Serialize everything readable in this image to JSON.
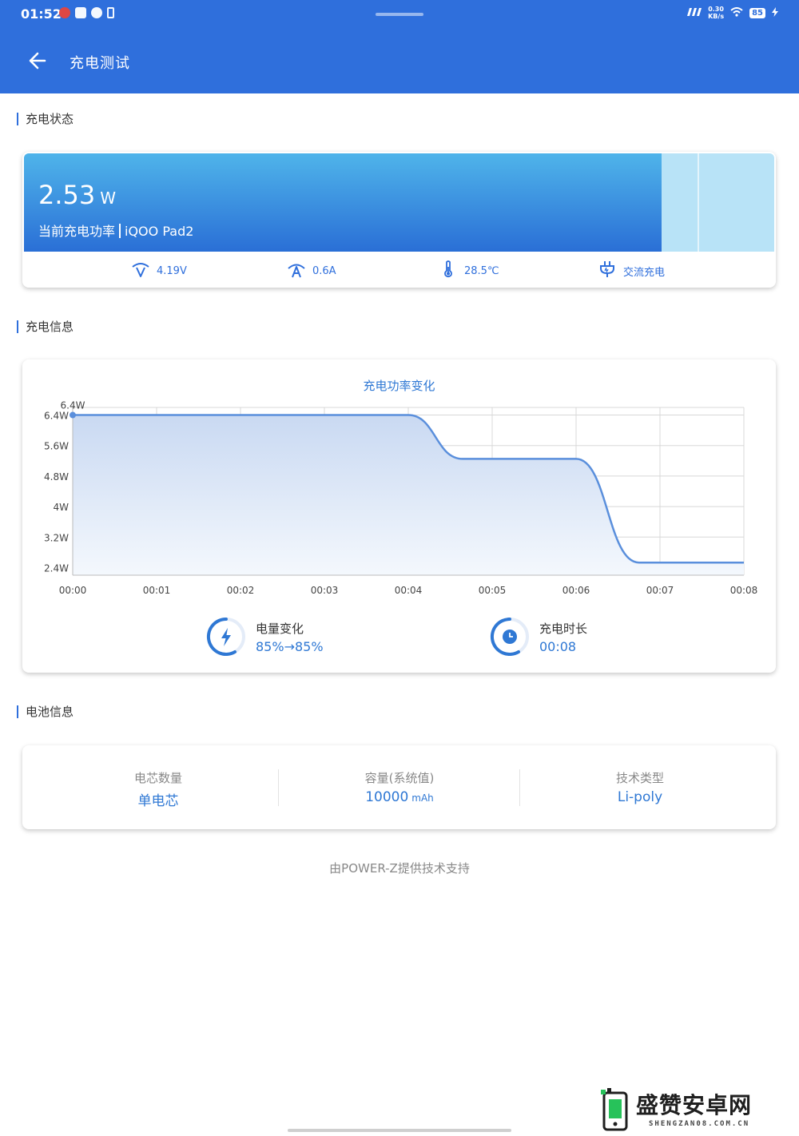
{
  "status_bar": {
    "time": "01:52",
    "net_speed_value": "0.30",
    "net_speed_unit": "KB/s",
    "battery": "85"
  },
  "header": {
    "title": "充电测试"
  },
  "sections": {
    "charge_status": "充电状态",
    "charge_info": "充电信息",
    "battery_info": "电池信息"
  },
  "charge_status": {
    "power_value": "2.53",
    "power_unit": "W",
    "caption_label": "当前充电功率",
    "device": "iQOO Pad2",
    "power_fraction": 0.85,
    "voltage": "4.19V",
    "current": "0.6A",
    "temperature": "28.5℃",
    "charger_type": "交流充电"
  },
  "chart_data": {
    "type": "area",
    "title": "充电功率变化",
    "x": [
      "00:00",
      "00:01",
      "00:02",
      "00:03",
      "00:04",
      "00:05",
      "00:06",
      "00:07",
      "00:08"
    ],
    "y_ticks": [
      "2.4W",
      "3.2W",
      "4W",
      "4.8W",
      "5.6W",
      "6.4W"
    ],
    "ylim": [
      2.2,
      6.6
    ],
    "series": [
      {
        "points": [
          [
            0,
            6.4
          ],
          [
            1,
            6.4
          ],
          [
            2,
            6.4
          ],
          [
            3,
            6.4
          ],
          [
            4,
            6.4
          ],
          [
            4.65,
            5.25
          ],
          [
            6,
            5.25
          ],
          [
            6.75,
            2.53
          ],
          [
            7,
            2.53
          ],
          [
            8,
            2.53
          ]
        ]
      }
    ],
    "annotation": "6.4W",
    "line_color": "#5a8fdc",
    "grid": true
  },
  "charge_summary": {
    "level_label": "电量变化",
    "level_value": "85%→85%",
    "duration_label": "充电时长",
    "duration_value": "00:08"
  },
  "battery": {
    "cells_label": "电芯数量",
    "cells_value": "单电芯",
    "capacity_label": "容量(系统值)",
    "capacity_value": "10000",
    "capacity_unit": "mAh",
    "tech_label": "技术类型",
    "tech_value": "Li-poly"
  },
  "footer": "由POWER-Z提供技术支持",
  "watermark": {
    "name": "盛赞安卓网",
    "url": "SHENGZAN08.COM.CN"
  },
  "colors": {
    "app_bar": "#2f6fdc",
    "accent": "#2f78d4"
  }
}
